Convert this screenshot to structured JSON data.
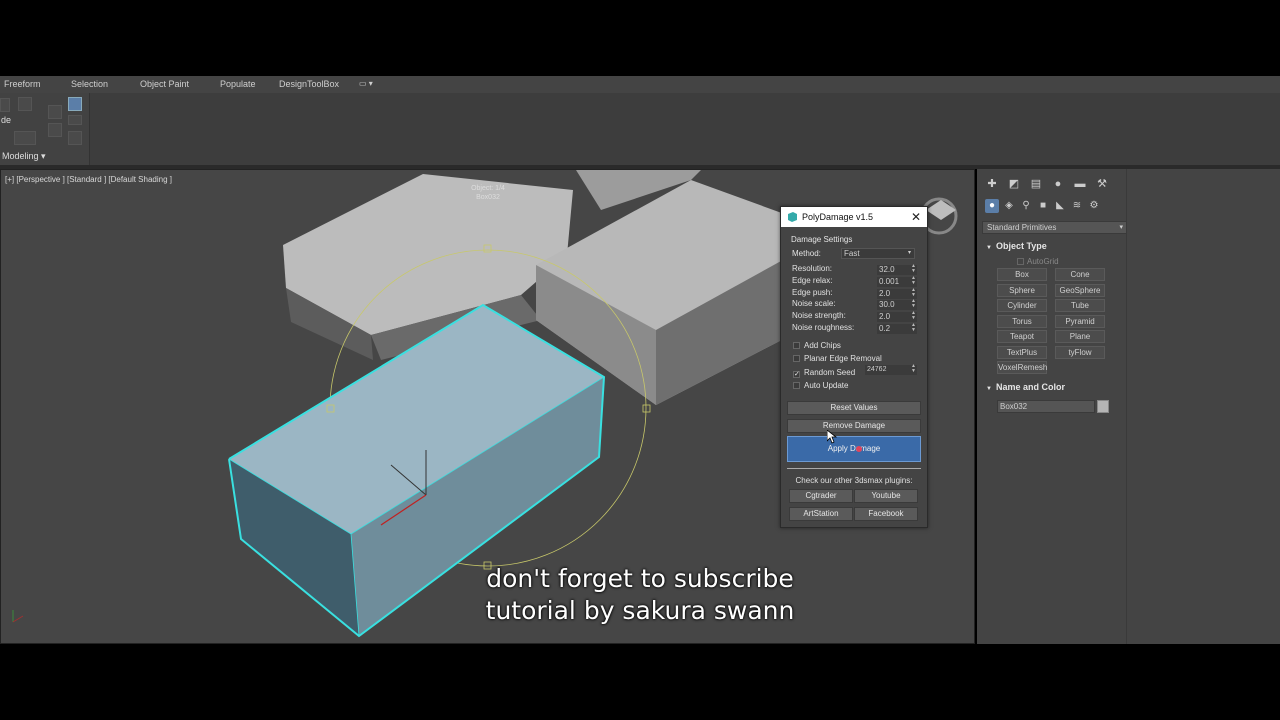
{
  "ribbon": {
    "tabs": [
      "Freeform",
      "Selection",
      "Object Paint",
      "Populate",
      "DesignToolBox"
    ],
    "panel_label": "Modeling",
    "partial_label": "de"
  },
  "viewport": {
    "label": "[+] [Perspective ] [Standard ] [Default Shading ]",
    "object_label_line1": "Object: 1/4",
    "object_label_line2": "Box032",
    "selected_box_color": "#9bb6c4",
    "selection_outline_color": "#39e0e0"
  },
  "command_panel": {
    "category": "Standard Primitives",
    "object_type_title": "Object Type",
    "autogrid_label": "AutoGrid",
    "primitives": [
      "Box",
      "Cone",
      "Sphere",
      "GeoSphere",
      "Cylinder",
      "Tube",
      "Torus",
      "Pyramid",
      "Teapot",
      "Plane",
      "TextPlus",
      "tyFlow",
      "VoxelRemesh"
    ],
    "name_color_title": "Name and Color",
    "object_name": "Box032"
  },
  "dialog": {
    "title": "PolyDamage v1.5",
    "section": "Damage Settings",
    "method_label": "Method:",
    "method_value": "Fast",
    "params": [
      {
        "label": "Resolution:",
        "value": "32.0"
      },
      {
        "label": "Edge relax:",
        "value": "0.001"
      },
      {
        "label": "Edge push:",
        "value": "2.0"
      },
      {
        "label": "Noise scale:",
        "value": "30.0"
      },
      {
        "label": "Noise strength:",
        "value": "2.0"
      },
      {
        "label": "Noise roughness:",
        "value": "0.2"
      }
    ],
    "checks": [
      {
        "label": "Add Chips",
        "checked": false
      },
      {
        "label": "Planar Edge Removal",
        "checked": false
      },
      {
        "label": "Random Seed",
        "checked": true
      },
      {
        "label": "Auto Update",
        "checked": false
      }
    ],
    "seed_value": "24762",
    "reset_label": "Reset Values",
    "remove_label": "Remove Damage",
    "apply_label": "Apply Damage",
    "promo_text": "Check our other 3dsmax plugins:",
    "links": [
      "Cgtrader",
      "Youtube",
      "ArtStation",
      "Facebook"
    ]
  },
  "subtitles": {
    "line1": "don't forget to subscribe",
    "line2": "tutorial by sakura swann"
  }
}
